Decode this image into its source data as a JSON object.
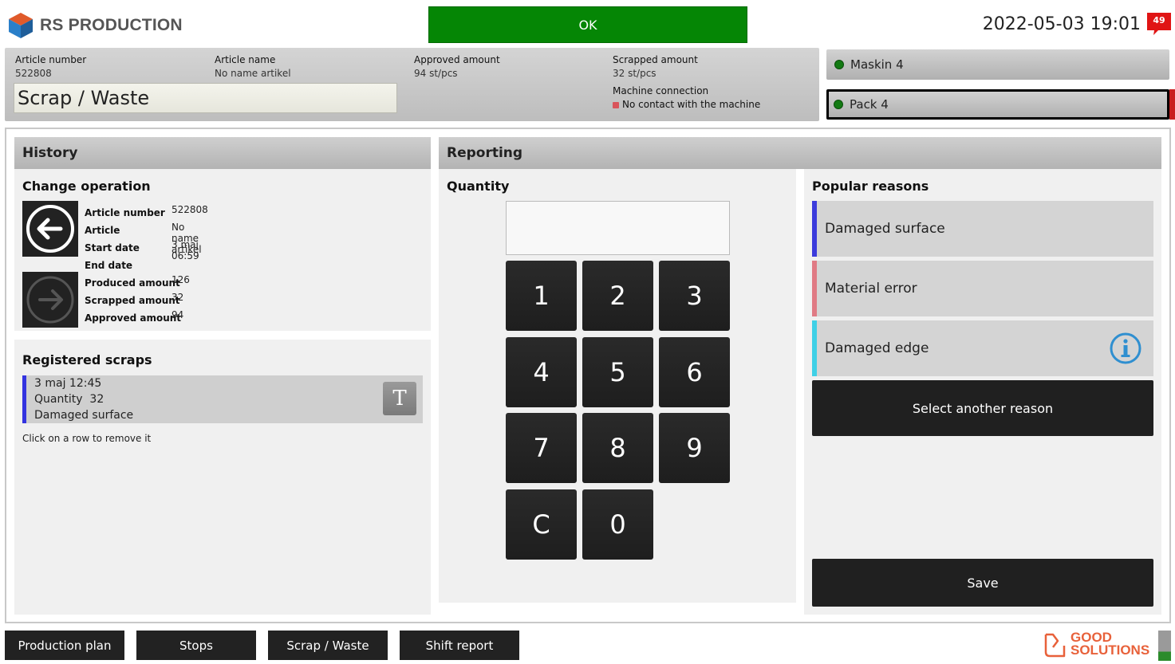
{
  "header": {
    "logo_text": "RS PRODUCTION",
    "status_button": "OK",
    "datetime": "2022-05-03 19:01",
    "notification_count": "49"
  },
  "info": {
    "article_number_label": "Article number",
    "article_number_value": "522808",
    "article_name_label": "Article name",
    "article_name_value": "No name artikel",
    "approved_label": "Approved amount",
    "approved_value": "94 st/pcs",
    "scrapped_label": "Scrapped amount",
    "scrapped_value": "32 st/pcs",
    "machine_conn_label": "Machine connection",
    "machine_conn_value": "No contact with the machine",
    "page_title": "Scrap / Waste"
  },
  "machines": [
    {
      "name": "Maskin 4"
    },
    {
      "name": "Pack 4"
    }
  ],
  "history": {
    "header": "History",
    "change_operation_title": "Change operation",
    "fields": [
      {
        "label": "Article number",
        "value": "522808"
      },
      {
        "label": "Article",
        "value": "No name artikel"
      },
      {
        "label": "Start date",
        "value": "3 maj 06:59"
      },
      {
        "label": "End date",
        "value": ""
      },
      {
        "label": "Produced amount",
        "value": "126"
      },
      {
        "label": "Scrapped amount",
        "value": "32"
      },
      {
        "label": "Approved amount",
        "value": "94"
      }
    ],
    "registered_title": "Registered scraps",
    "scraps": [
      {
        "date": "3 maj 12:45",
        "quantity_label": "Quantity",
        "quantity": "32",
        "reason": "Damaged surface",
        "type_button": "T"
      }
    ],
    "hint": "Click on a row to remove it"
  },
  "reporting": {
    "header": "Reporting",
    "quantity_title": "Quantity",
    "quantity_value": "",
    "keys": [
      "1",
      "2",
      "3",
      "4",
      "5",
      "6",
      "7",
      "8",
      "9",
      "C",
      "0"
    ],
    "popular_title": "Popular reasons",
    "reasons": [
      {
        "label": "Damaged surface",
        "color": "#3b3bdc"
      },
      {
        "label": "Material error",
        "color": "#e07a84"
      },
      {
        "label": "Damaged edge",
        "color": "#3fd0e6"
      }
    ],
    "select_other": "Select another reason",
    "save": "Save"
  },
  "bottom_nav": [
    "Production plan",
    "Stops",
    "Scrap / Waste",
    "Shift report"
  ],
  "footer_logo": {
    "line1": "GOOD",
    "line2": "SOLUTIONS"
  }
}
